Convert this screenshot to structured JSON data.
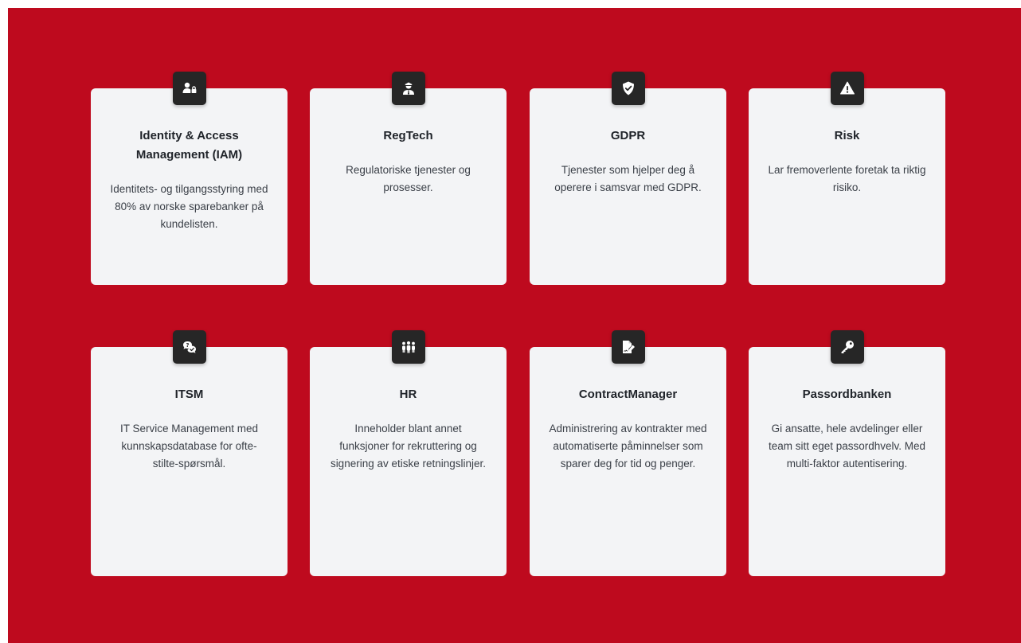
{
  "colors": {
    "background": "#be0a1e",
    "card": "#f3f4f6",
    "badge": "#262626"
  },
  "cards": [
    {
      "icon": "user-lock-icon",
      "title": "Identity & Access Management (IAM)",
      "description": "Identitets- og tilgangsstyring med 80% av norske sparebanker på kundelisten."
    },
    {
      "icon": "user-tie-icon",
      "title": "RegTech",
      "description": "Regulatoriske tjenester og prosesser."
    },
    {
      "icon": "shield-check-icon",
      "title": "GDPR",
      "description": "Tjenester som hjelper deg å operere i samsvar med GDPR."
    },
    {
      "icon": "warning-triangle-icon",
      "title": "Risk",
      "description": "Lar fremoverlente foretak ta riktig risiko."
    },
    {
      "icon": "comments-question-icon",
      "title": "ITSM",
      "description": "IT Service Management med kunnskapsdatabase for ofte-stilte-spørsmål."
    },
    {
      "icon": "people-group-icon",
      "title": "HR",
      "description": "Inneholder blant annet funksjoner for rekruttering og signering av etiske retningslinjer."
    },
    {
      "icon": "file-signature-icon",
      "title": "ContractManager",
      "description": "Administrering av kontrakter med automatiserte påminnelser som sparer deg for tid og penger."
    },
    {
      "icon": "key-icon",
      "title": "Passordbanken",
      "description": "Gi ansatte, hele avdelinger eller team sitt eget passordhvelv. Med multi-faktor autentisering."
    }
  ]
}
